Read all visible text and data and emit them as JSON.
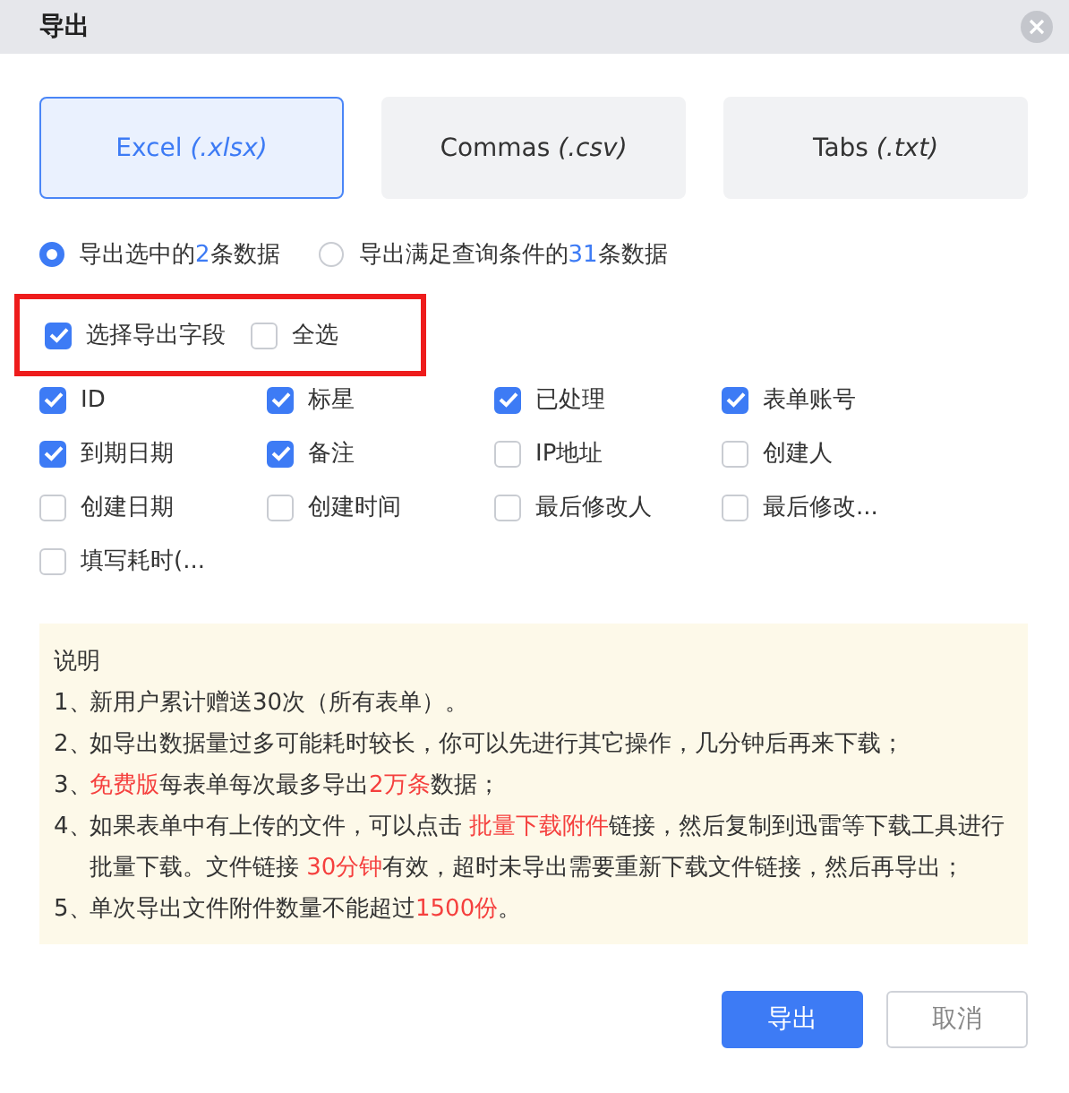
{
  "window": {
    "title": "导出"
  },
  "formats": [
    {
      "label": "Excel *(.xlsx)*",
      "selected": true
    },
    {
      "label": "Commas *(.csv)*",
      "selected": false
    },
    {
      "label": "Tabs *(.txt)*",
      "selected": false
    }
  ],
  "scope": [
    {
      "selected": true,
      "parts": [
        {
          "text": "导出选中的",
          "highlight": false
        },
        {
          "text": "2",
          "highlight": true
        },
        {
          "text": "条数据",
          "highlight": false
        }
      ]
    },
    {
      "selected": false,
      "parts": [
        {
          "text": "导出满足查询条件的",
          "highlight": false
        },
        {
          "text": "31",
          "highlight": true
        },
        {
          "text": "条数据",
          "highlight": false
        }
      ]
    }
  ],
  "field_header": {
    "outlined": true,
    "items": [
      {
        "label": "选择导出字段",
        "checked": true
      },
      {
        "label": "全选",
        "checked": false
      }
    ]
  },
  "fields": [
    {
      "label": "ID",
      "checked": true
    },
    {
      "label": "标星",
      "checked": true
    },
    {
      "label": "已处理",
      "checked": true
    },
    {
      "label": "表单账号",
      "checked": true
    },
    {
      "label": "到期日期",
      "checked": true
    },
    {
      "label": "备注",
      "checked": true
    },
    {
      "label": "IP地址",
      "checked": false
    },
    {
      "label": "创建人",
      "checked": false
    },
    {
      "label": "创建日期",
      "checked": false
    },
    {
      "label": "创建时间",
      "checked": false
    },
    {
      "label": "最后修改人",
      "checked": false
    },
    {
      "label": "最后修改...",
      "checked": false
    },
    {
      "label": "填写耗时(...",
      "checked": false
    }
  ],
  "notes": {
    "title": "说明",
    "items": [
      {
        "number": "1、",
        "parts": [
          {
            "text": "新用户累计赠送30次（所有表单）。",
            "highlight": false
          }
        ]
      },
      {
        "number": "2、",
        "parts": [
          {
            "text": "如导出数据量过多可能耗时较长，你可以先进行其它操作，几分钟后再来下载；",
            "highlight": false
          }
        ]
      },
      {
        "number": "3、",
        "parts": [
          {
            "text": "免费版",
            "highlight": true
          },
          {
            "text": "每表单每次最多导出",
            "highlight": false
          },
          {
            "text": "2万条",
            "highlight": true
          },
          {
            "text": "数据；",
            "highlight": false
          }
        ]
      },
      {
        "number": "4、",
        "parts": [
          {
            "text": "如果表单中有上传的文件，可以点击 ",
            "highlight": false
          },
          {
            "text": "批量下载附件",
            "highlight": true
          },
          {
            "text": "链接，然后复制到迅雷等下载工具进行批量下载。文件链接 ",
            "highlight": false
          },
          {
            "text": "30分钟",
            "highlight": true
          },
          {
            "text": "有效，超时未导出需要重新下载文件链接，然后再导出；",
            "highlight": false
          }
        ]
      },
      {
        "number": "5、",
        "parts": [
          {
            "text": "单次导出文件附件数量不能超过",
            "highlight": false
          },
          {
            "text": "1500份",
            "highlight": true
          },
          {
            "text": "。",
            "highlight": false
          }
        ]
      }
    ]
  },
  "buttons": [
    {
      "label": "导出",
      "kind": "primary"
    },
    {
      "label": "取消",
      "kind": "default"
    }
  ]
}
